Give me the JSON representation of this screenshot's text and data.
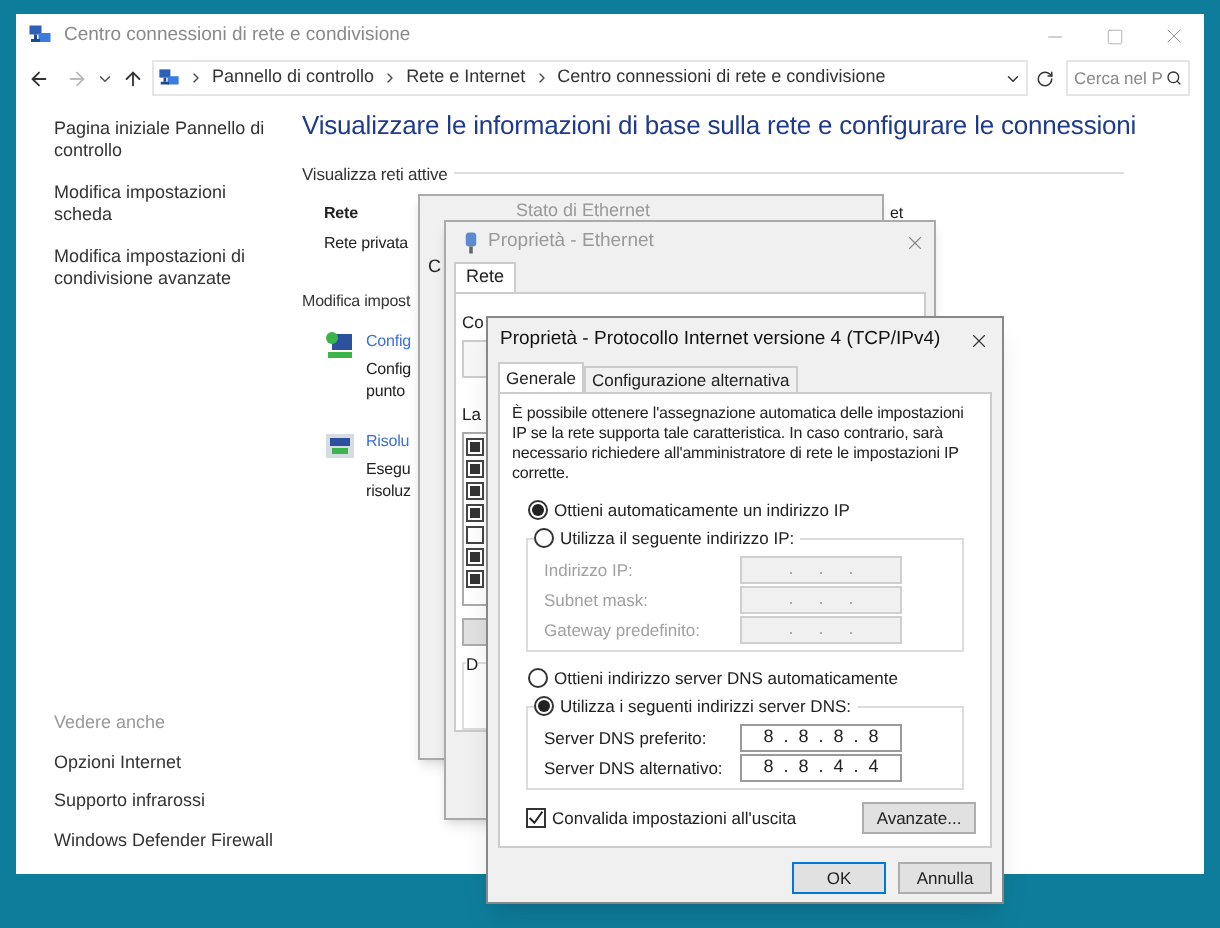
{
  "main_window": {
    "title": "Centro connessioni di rete e condivisione",
    "breadcrumb": [
      "Pannello di controllo",
      "Rete e Internet",
      "Centro connessioni di rete e condivisione"
    ],
    "search": {
      "placeholder": "Cerca nel P"
    },
    "sidebar": {
      "links": [
        "Pagina iniziale Pannello di controllo",
        "Modifica impostazioni scheda",
        "Modifica impostazioni di condivisione avanzate"
      ],
      "see_also": {
        "heading": "Vedere anche",
        "links": [
          "Opzioni Internet",
          "Supporto infrarossi",
          "Windows Defender Firewall"
        ]
      }
    },
    "heading": "Visualizzare le informazioni di base sulla rete e configurare le connessioni",
    "active_networks": {
      "label": "Visualizza reti attive",
      "name": "Rete",
      "type": "Rete privata",
      "connection_fragment": "et"
    },
    "settings": {
      "label": "Modifica impost",
      "tasks": [
        {
          "kind": "setup",
          "link": "Config",
          "description": [
            "Config",
            "punto"
          ]
        },
        {
          "kind": "troubleshoot",
          "link": "Risolu",
          "description": [
            "Esegu",
            "risoluz"
          ]
        }
      ]
    }
  },
  "status_window": {
    "title": "Stato di Ethernet",
    "label_fragment": "C"
  },
  "ethernet_window": {
    "title": "Proprietà - Ethernet",
    "tabs": [
      {
        "label": "Rete",
        "selected": true
      }
    ],
    "connection_label": "Co",
    "items_label": "La",
    "items": [
      {
        "checked": true
      },
      {
        "checked": true
      },
      {
        "checked": true
      },
      {
        "checked": true
      },
      {
        "checked": false
      },
      {
        "checked": true
      },
      {
        "checked": true
      }
    ],
    "description_label": "D"
  },
  "ipv4_window": {
    "title": "Proprietà - Protocollo Internet versione 4 (TCP/IPv4)",
    "tabs": [
      {
        "label": "Generale",
        "selected": true
      },
      {
        "label": "Configurazione alternativa",
        "selected": false
      }
    ],
    "intro": "È possibile ottenere l'assegnazione automatica delle impostazioni IP se la rete supporta tale caratteristica. In caso contrario, sarà necessario richiedere all'amministratore di rete le impostazioni IP corrette.",
    "ip": {
      "options": [
        {
          "label": "Ottieni automaticamente un indirizzo IP",
          "selected": true
        },
        {
          "label": "Utilizza il seguente indirizzo IP:",
          "selected": false
        }
      ],
      "disabled": true,
      "fields": [
        {
          "label": "Indirizzo IP:",
          "value": ".     .     ."
        },
        {
          "label": "Subnet mask:",
          "value": ".     .     ."
        },
        {
          "label": "Gateway predefinito:",
          "value": ".     .     ."
        }
      ]
    },
    "dns": {
      "options": [
        {
          "label": "Ottieni indirizzo server DNS automaticamente",
          "selected": false
        },
        {
          "label": "Utilizza i seguenti indirizzi server DNS:",
          "selected": true
        }
      ],
      "disabled": false,
      "fields": [
        {
          "label": "Server DNS preferito:",
          "value": "8  .  8  .  8  .  8"
        },
        {
          "label": "Server DNS alternativo:",
          "value": "8  .  8  .  4  .  4"
        }
      ]
    },
    "validate": {
      "label": "Convalida impostazioni all'uscita",
      "checked": true
    },
    "advanced_button": "Avanzate...",
    "buttons": [
      {
        "label": "OK",
        "default": true
      },
      {
        "label": "Annulla",
        "default": false
      }
    ]
  }
}
